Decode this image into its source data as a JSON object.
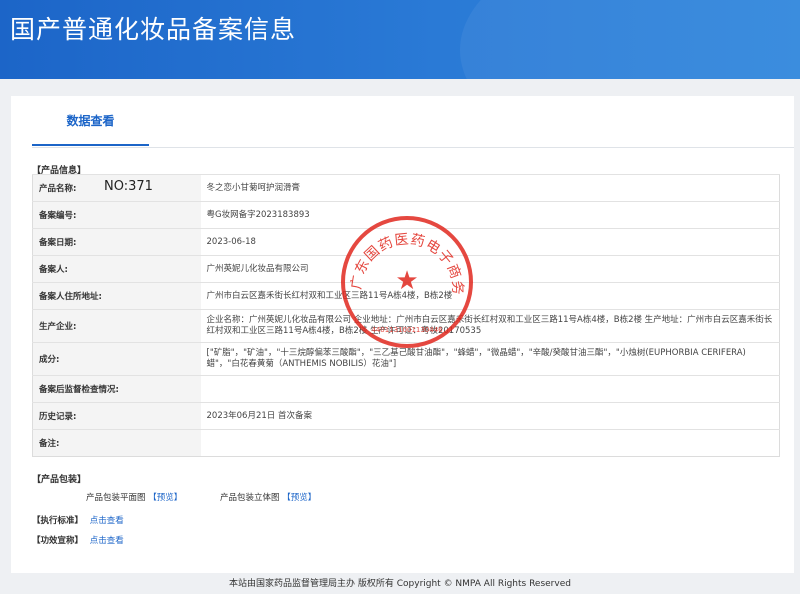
{
  "header": {
    "title": "国产普通化妆品备案信息"
  },
  "tab": {
    "label": "数据查看"
  },
  "product_info": {
    "section_label": "【产品信息】",
    "rows": [
      {
        "label": "产品名称:",
        "value": "冬之恋小甘菊呵护润滑膏"
      },
      {
        "label": "备案编号:",
        "value": "粤G妆网备字2023183893"
      },
      {
        "label": "备案日期:",
        "value": "2023-06-18"
      },
      {
        "label": "备案人:",
        "value": "广州英妮儿化妆品有限公司"
      },
      {
        "label": "备案人住所地址:",
        "value": "广州市白云区嘉禾街长红村双和工业区三路11号A栋4楼，B栋2楼"
      },
      {
        "label": "生产企业:",
        "value": "企业名称：广州英妮儿化妆品有限公司 企业地址：广州市白云区嘉禾街长红村双和工业区三路11号A栋4楼，B栋2楼 生产地址：广州市白云区嘉禾街长红村双和工业区三路11号A栋4楼，B栋2楼 生产许可证：粤妆20170535"
      },
      {
        "label": "成分:",
        "value": "[\"矿脂\"，\"矿油\"，\"十三烷醇偏苯三酸酯\"，\"三乙基己酸甘油酯\"，\"蜂蜡\"，\"微晶蜡\"，\"辛酸/癸酸甘油三酯\"，\"小烛树(EUPHORBIA CERIFERA)蜡\"，\"白花春黄菊（ANTHEMIS NOBILIS）花油\"]"
      },
      {
        "label": "备案后监督检查情况:",
        "value": ""
      },
      {
        "label": "历史记录:",
        "value": "2023年06月21日 首次备案"
      },
      {
        "label": "备注:",
        "value": ""
      }
    ],
    "overlay_no": "NO:371"
  },
  "packaging": {
    "section_label": "【产品包装】",
    "flat_label": "产品包装平面图",
    "flat_link": "【预览】",
    "solid_label": "产品包装立体图",
    "solid_link": "【预览】"
  },
  "standard": {
    "label": "【执行标准】",
    "link": "点击查看"
  },
  "efficacy": {
    "label": "【功效宣称】",
    "link": "点击查看"
  },
  "stamp": {
    "text": "广东国药医药电子商务有限公司",
    "code": "4401131001130446",
    "color": "#e0281e"
  },
  "footer": {
    "text": "本站由国家药品监督管理局主办 版权所有 Copyright © NMPA All Rights Reserved"
  },
  "colors": {
    "accent": "#1c65c8",
    "banner": "#2a7ad6"
  }
}
